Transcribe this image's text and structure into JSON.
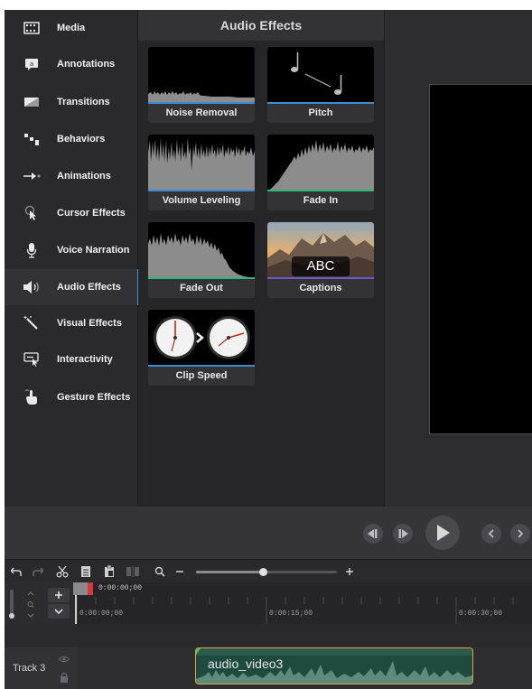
{
  "sidebar": {
    "items": [
      {
        "label": "Media",
        "icon": "film-icon"
      },
      {
        "label": "Annotations",
        "icon": "annotation-icon"
      },
      {
        "label": "Transitions",
        "icon": "transition-icon"
      },
      {
        "label": "Behaviors",
        "icon": "behaviors-icon"
      },
      {
        "label": "Animations",
        "icon": "animation-arrow-icon"
      },
      {
        "label": "Cursor Effects",
        "icon": "cursor-icon"
      },
      {
        "label": "Voice Narration",
        "icon": "microphone-icon"
      },
      {
        "label": "Audio Effects",
        "icon": "speaker-icon"
      },
      {
        "label": "Visual Effects",
        "icon": "magic-wand-icon"
      },
      {
        "label": "Interactivity",
        "icon": "interactivity-icon"
      },
      {
        "label": "Gesture Effects",
        "icon": "hand-gesture-icon"
      }
    ],
    "active_index": 7
  },
  "library": {
    "title": "Audio Effects",
    "tiles": [
      {
        "label": "Noise Removal",
        "accent": "#3d8bd9"
      },
      {
        "label": "Pitch",
        "accent": "#3d8bd9"
      },
      {
        "label": "Volume Leveling",
        "accent": "#3d8bd9"
      },
      {
        "label": "Fade In",
        "accent": "#2eb87a"
      },
      {
        "label": "Fade Out",
        "accent": "#2eb87a"
      },
      {
        "label": "Captions",
        "accent": "#6a5acd",
        "overlay_text": "ABC"
      },
      {
        "label": "Clip Speed",
        "accent": "#3d8bd9"
      }
    ]
  },
  "timeline": {
    "playhead_time": "0:00:00;00",
    "ruler_marks": [
      "0:00:00;00",
      "0:00:15;00",
      "0:00:30;00"
    ],
    "track_label": "Track 3",
    "clip_name": "audio_video3",
    "clip_border": "#d9a441",
    "clip_fill": "#1f4a40"
  },
  "colors": {
    "active_accent": "#4a90d9",
    "playhead_marker": "#d9363e"
  }
}
